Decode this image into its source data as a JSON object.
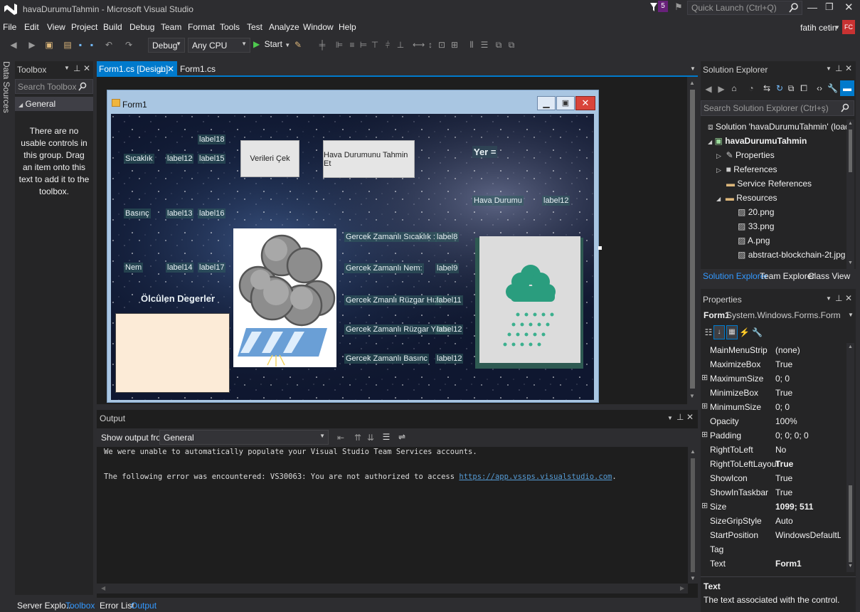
{
  "window": {
    "title": "havaDurumuTahmin - Microsoft Visual Studio",
    "notifications": "5",
    "quick_launch_placeholder": "Quick Launch (Ctrl+Q)",
    "user": "fatih cetin",
    "user_initials": "FC"
  },
  "menu": [
    "File",
    "Edit",
    "View",
    "Project",
    "Build",
    "Debug",
    "Team",
    "Format",
    "Tools",
    "Test",
    "Analyze",
    "Window",
    "Help"
  ],
  "toolbar": {
    "config": "Debug",
    "platform": "Any CPU",
    "start_label": "Start"
  },
  "left_strip": {
    "data_sources": "Data Sources"
  },
  "toolbox": {
    "title": "Toolbox",
    "search_placeholder": "Search Toolbox",
    "group": "General",
    "empty_text": "There are no usable controls in this group. Drag an item onto this text to add it to the toolbox."
  },
  "doc_tabs": [
    {
      "label": "Form1.cs [Design]",
      "active": true
    },
    {
      "label": "Form1.cs",
      "active": false
    }
  ],
  "form": {
    "title": "Form1",
    "labels": {
      "label18": "label18",
      "sicaklik": "Sıcaklık",
      "label12a": "label12",
      "label15": "label15",
      "basinc": "Basınç",
      "label13": "label13",
      "label16": "label16",
      "nem": "Nem",
      "label14": "label14",
      "label17": "label17",
      "olculen": "Ölcülen Degerler",
      "rt_sicaklik": "Gercek Zamanlı Sıcaklık :",
      "label8": "label8",
      "rt_nem": "Gercek Zamanlı Nem:",
      "label9": "label9",
      "rt_ruzgar_hizi": "Gercek Zmanlı Rüzgar Hızı",
      "label11": "label11",
      "rt_ruzgar_yonu": "Gercek Zamanlı Rüzgar Yönü",
      "label12b": "label12",
      "rt_basinc": "Gercek Zamanlı Basınc",
      "label12c": "label12",
      "yer": "Yer =",
      "hava_durumu": "Hava Durumu",
      "label12d": "label12"
    },
    "buttons": {
      "verileri_cek": "Verileri Çek",
      "tahmin": "Hava Durumunu Tahmin Et"
    }
  },
  "output": {
    "title": "Output",
    "show_from_label": "Show output from:",
    "source": "General",
    "line1": "We were unable to automatically populate your Visual Studio Team Services accounts.",
    "line2_prefix": "The following error was encountered: VS30063: You are not authorized to access ",
    "line2_link": "https://app.vssps.visualstudio.com",
    "line2_suffix": "."
  },
  "solution_explorer": {
    "title": "Solution Explorer",
    "search_placeholder": "Search Solution Explorer (Ctrl+ş)",
    "items": [
      {
        "label": "Solution 'havaDurumuTahmin' (loading...)"
      },
      {
        "label": "havaDurumuTahmin"
      },
      {
        "label": "Properties"
      },
      {
        "label": "References"
      },
      {
        "label": "Service References"
      },
      {
        "label": "Resources"
      },
      {
        "label": "20.png"
      },
      {
        "label": "33.png"
      },
      {
        "label": "A.png"
      },
      {
        "label": "abstract-blockchain-2t.jpg"
      }
    ],
    "tabs": [
      "Solution Explorer",
      "Team Explorer",
      "Class View"
    ]
  },
  "properties": {
    "title": "Properties",
    "object_name": "Form1",
    "object_type": "System.Windows.Forms.Form",
    "rows": [
      {
        "name": "MainMenuStrip",
        "value": "(none)",
        "exp": "",
        "bold": false
      },
      {
        "name": "MaximizeBox",
        "value": "True",
        "exp": "",
        "bold": false
      },
      {
        "name": "MaximumSize",
        "value": "0; 0",
        "exp": "⊞",
        "bold": false
      },
      {
        "name": "MinimizeBox",
        "value": "True",
        "exp": "",
        "bold": false
      },
      {
        "name": "MinimumSize",
        "value": "0; 0",
        "exp": "⊞",
        "bold": false
      },
      {
        "name": "Opacity",
        "value": "100%",
        "exp": "",
        "bold": false
      },
      {
        "name": "Padding",
        "value": "0; 0; 0; 0",
        "exp": "⊞",
        "bold": false
      },
      {
        "name": "RightToLeft",
        "value": "No",
        "exp": "",
        "bold": false
      },
      {
        "name": "RightToLeftLayout",
        "value": "True",
        "exp": "",
        "bold": true
      },
      {
        "name": "ShowIcon",
        "value": "True",
        "exp": "",
        "bold": false
      },
      {
        "name": "ShowInTaskbar",
        "value": "True",
        "exp": "",
        "bold": false
      },
      {
        "name": "Size",
        "value": "1099; 511",
        "exp": "⊞",
        "bold": true
      },
      {
        "name": "SizeGripStyle",
        "value": "Auto",
        "exp": "",
        "bold": false
      },
      {
        "name": "StartPosition",
        "value": "WindowsDefaultLocation",
        "exp": "",
        "bold": false
      },
      {
        "name": "Tag",
        "value": "",
        "exp": "",
        "bold": false
      },
      {
        "name": "Text",
        "value": "Form1",
        "exp": "",
        "bold": true
      }
    ],
    "desc_title": "Text",
    "desc_text": "The text associated with the control."
  },
  "bottom_tabs": {
    "left": [
      "Server Explo...",
      "Toolbox"
    ],
    "output": [
      "Error List",
      "Output"
    ]
  },
  "colors": {
    "accent": "#007acc",
    "link": "#569cd6",
    "chrome": "#2d2d30",
    "panel": "#252526",
    "editor": "#1e1e1e"
  }
}
